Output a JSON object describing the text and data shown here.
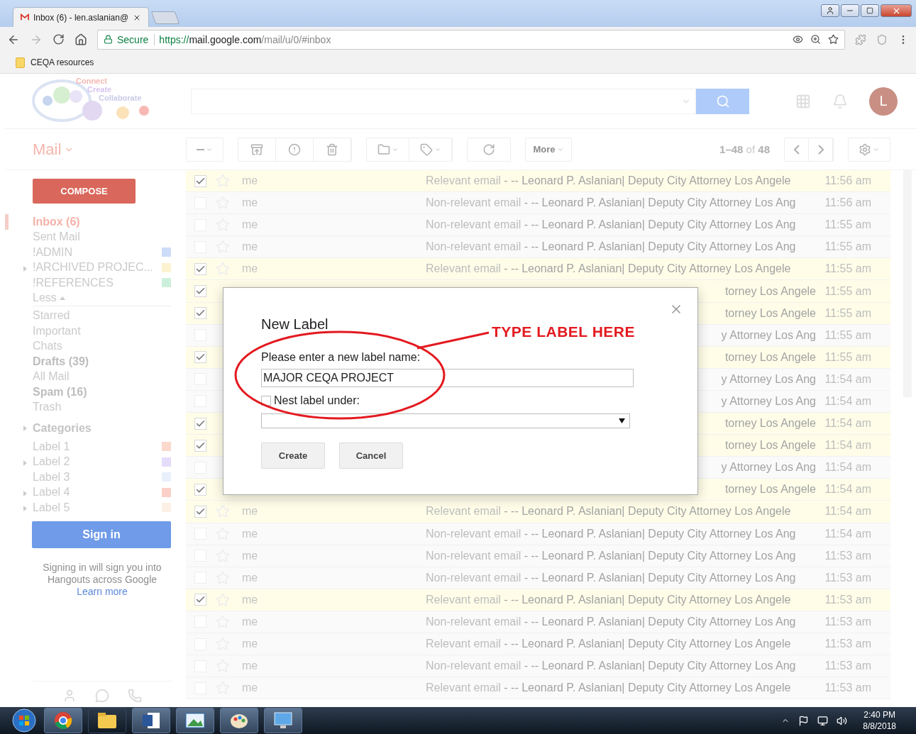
{
  "browser": {
    "tab_title": "Inbox (6) - len.aslanian@",
    "security": "Secure",
    "url_scheme": "https://",
    "url_host": "mail.google.com",
    "url_path": "/mail/u/0/#inbox",
    "bookmarks": [
      "CEQA resources"
    ]
  },
  "header": {
    "logo_lines": [
      "Connect",
      "Create",
      "Collaborate"
    ],
    "avatar": "L"
  },
  "app_menu": "Mail",
  "toolbar": {
    "more": "More",
    "range": "**1–48** of **48**"
  },
  "sidebar": {
    "compose": "COMPOSE",
    "items": [
      {
        "label": "Inbox (6)",
        "selected": true,
        "unread": true,
        "expandable": false
      },
      {
        "label": "Sent Mail",
        "selected": false,
        "unread": false,
        "expandable": false
      },
      {
        "label": "!ADMIN",
        "selected": false,
        "unread": false,
        "expandable": false,
        "color": "#cddcf7"
      },
      {
        "label": "!ARCHIVED PROJEC...",
        "selected": false,
        "unread": false,
        "expandable": true,
        "color": "#fdf3d1"
      },
      {
        "label": "!REFERENCES",
        "selected": false,
        "unread": false,
        "expandable": false,
        "color": "#cdf0dc"
      }
    ],
    "less": "Less",
    "more_items": [
      {
        "label": "Starred",
        "selected": false,
        "unread": false,
        "expandable": false
      },
      {
        "label": "Important",
        "selected": false,
        "unread": false,
        "expandable": false
      },
      {
        "label": "Chats",
        "selected": false,
        "unread": false,
        "expandable": false
      },
      {
        "label": "Drafts (39)",
        "selected": false,
        "unread": true,
        "expandable": false
      },
      {
        "label": "All Mail",
        "selected": false,
        "unread": false,
        "expandable": false
      },
      {
        "label": "Spam (16)",
        "selected": false,
        "unread": true,
        "expandable": false
      },
      {
        "label": "Trash",
        "selected": false,
        "unread": false,
        "expandable": false
      }
    ],
    "categories": "Categories",
    "labels": [
      {
        "label": "Label 1",
        "selected": false,
        "unread": false,
        "expandable": false,
        "color": "#fbd9cc"
      },
      {
        "label": "Label 2",
        "selected": false,
        "unread": false,
        "expandable": true,
        "color": "#e5dcfb"
      },
      {
        "label": "Label 3",
        "selected": false,
        "unread": false,
        "expandable": false,
        "color": "#e9f0fc"
      },
      {
        "label": "Label 4",
        "selected": false,
        "unread": false,
        "expandable": true,
        "color": "#fbd0c9"
      },
      {
        "label": "Label 5",
        "selected": false,
        "unread": false,
        "expandable": true,
        "color": "#fdf0e4"
      }
    ],
    "sign_in": "Sign in",
    "sign_in_note": "Signing in will sign you into Hangouts across Google",
    "learn_more": "Learn more"
  },
  "rows": [
    {
      "kind": "full",
      "checked": true,
      "sender": "me",
      "subject": "Relevant email",
      "snippet": "- -- Leonard P. Aslanian| Deputy City Attorney Los Angele",
      "time": "11:56 am"
    },
    {
      "kind": "full",
      "checked": false,
      "sender": "me",
      "subject": "Non-relevant email",
      "snippet": "- -- Leonard P. Aslanian| Deputy City Attorney Los Ang",
      "time": "11:56 am"
    },
    {
      "kind": "full",
      "checked": false,
      "sender": "me",
      "subject": "Non-relevant email",
      "snippet": "- -- Leonard P. Aslanian| Deputy City Attorney Los Ang",
      "time": "11:55 am"
    },
    {
      "kind": "full",
      "checked": false,
      "sender": "me",
      "subject": "Non-relevant email",
      "snippet": "- -- Leonard P. Aslanian| Deputy City Attorney Los Ang",
      "time": "11:55 am"
    },
    {
      "kind": "full",
      "checked": true,
      "sender": "me",
      "subject": "Relevant email",
      "snippet": "- -- Leonard P. Aslanian| Deputy City Attorney Los Angele",
      "time": "11:55 am"
    },
    {
      "kind": "covered",
      "checked": true,
      "tail": "torney Los Angele",
      "time": "11:55 am"
    },
    {
      "kind": "covered",
      "checked": true,
      "tail": "torney Los Angele",
      "time": "11:55 am"
    },
    {
      "kind": "covered",
      "checked": false,
      "tail": "y Attorney Los Ang",
      "time": "11:55 am"
    },
    {
      "kind": "covered",
      "checked": true,
      "tail": "torney Los Angele",
      "time": "11:55 am"
    },
    {
      "kind": "covered",
      "checked": false,
      "tail": "y Attorney Los Ang",
      "time": "11:54 am"
    },
    {
      "kind": "covered",
      "checked": false,
      "tail": "y Attorney Los Ang",
      "time": "11:54 am"
    },
    {
      "kind": "covered",
      "checked": true,
      "tail": "torney Los Angele",
      "time": "11:54 am"
    },
    {
      "kind": "covered",
      "checked": true,
      "tail": "torney Los Angele",
      "time": "11:54 am"
    },
    {
      "kind": "covered",
      "checked": false,
      "tail": "y Attorney Los Ang",
      "time": "11:54 am"
    },
    {
      "kind": "covered",
      "checked": true,
      "tail": "torney Los Angele",
      "time": "11:54 am"
    },
    {
      "kind": "full",
      "checked": true,
      "sender": "me",
      "subject": "Relevant email",
      "snippet": "- -- Leonard P. Aslanian| Deputy City Attorney Los Angele",
      "time": "11:54 am"
    },
    {
      "kind": "full",
      "checked": false,
      "sender": "me",
      "subject": "Non-relevant email",
      "snippet": "- -- Leonard P. Aslanian| Deputy City Attorney Los Ang",
      "time": "11:54 am"
    },
    {
      "kind": "full",
      "checked": false,
      "sender": "me",
      "subject": "Non-relevant email",
      "snippet": "- -- Leonard P. Aslanian| Deputy City Attorney Los Ang",
      "time": "11:53 am"
    },
    {
      "kind": "full",
      "checked": false,
      "sender": "me",
      "subject": "Non-relevant email",
      "snippet": "- -- Leonard P. Aslanian| Deputy City Attorney Los Ang",
      "time": "11:53 am"
    },
    {
      "kind": "full",
      "checked": true,
      "sender": "me",
      "subject": "Relevant email",
      "snippet": "- -- Leonard P. Aslanian| Deputy City Attorney Los Angele",
      "time": "11:53 am"
    },
    {
      "kind": "full",
      "checked": false,
      "sender": "me",
      "subject": "Non-relevant email",
      "snippet": "- -- Leonard P. Aslanian| Deputy City Attorney Los Ang",
      "time": "11:53 am"
    },
    {
      "kind": "full",
      "checked": false,
      "sender": "me",
      "subject": "Relevant email",
      "snippet": "- -- Leonard P. Aslanian| Deputy City Attorney Los Angele",
      "time": "11:53 am"
    },
    {
      "kind": "full",
      "checked": false,
      "sender": "me",
      "subject": "Non-relevant email",
      "snippet": "- -- Leonard P. Aslanian| Deputy City Attorney Los Ang",
      "time": "11:53 am"
    },
    {
      "kind": "full",
      "checked": false,
      "sender": "me",
      "subject": "Relevant email",
      "snippet": "- -- Leonard P. Aslanian| Deputy City Attorney Los Angele",
      "time": "11:53 am"
    }
  ],
  "dialog": {
    "title": "New Label",
    "prompt": "Please enter a new label name:",
    "value": "MAJOR CEQA PROJECT",
    "nest_label": "Nest label under:",
    "nest_checked": false,
    "buttons": [
      "Create",
      "Cancel"
    ],
    "annotation": "TYPE LABEL HERE"
  },
  "taskbar": {
    "time": "2:40 PM",
    "date": "8/8/2018"
  }
}
